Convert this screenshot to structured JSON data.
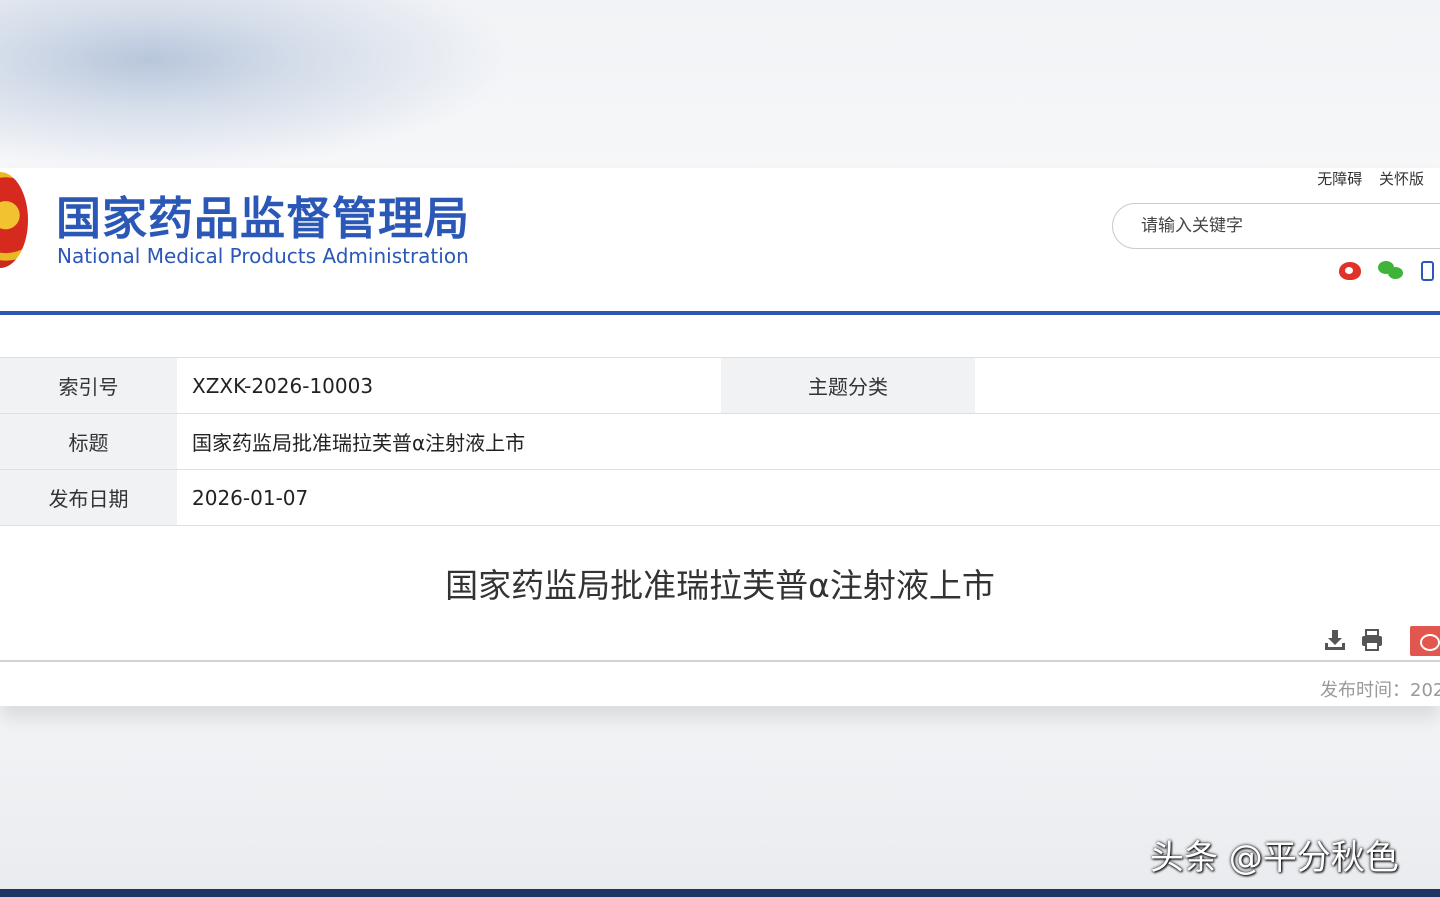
{
  "header": {
    "title": "国家药品监督管理局",
    "subtitle": "National Medical Products Administration",
    "top_links": [
      "无障碍",
      "关怀版"
    ],
    "search_placeholder": "请输入关键字",
    "social_icons": [
      "weibo-icon",
      "wechat-icon",
      "mobile-icon"
    ],
    "accent_color": "#2c56b0"
  },
  "info": {
    "index_label": "索引号",
    "index_value": "XZXK-2026-10003",
    "category_label": "主题分类",
    "title_label": "标题",
    "title_value": "国家药监局批准瑞拉芙普α注射液上市",
    "date_label": "发布日期",
    "date_value": "2026-01-07"
  },
  "article": {
    "title": "国家药监局批准瑞拉芙普α注射液上市",
    "tools": [
      "download-icon",
      "print-icon",
      "weibo-share-icon"
    ],
    "publish_time": "发布时间：202"
  },
  "watermark": "头条 @平分秋色"
}
